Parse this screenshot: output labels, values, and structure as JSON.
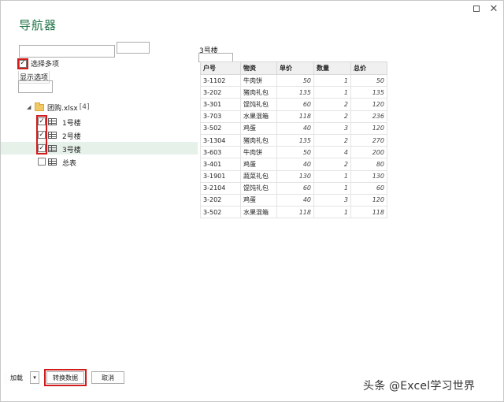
{
  "window": {
    "title": "导航器",
    "maximize_icon": "maximize-icon",
    "close_icon": "close-icon",
    "close_glyph": "☐",
    "x_glyph": "✕"
  },
  "left": {
    "search_value": "",
    "select_multiple_label": "选择多项",
    "select_multiple_checked": true,
    "display_options_label": "显示选项",
    "tree": {
      "root_label": "团购.xlsx",
      "root_count": "[4]",
      "items": [
        {
          "label": "1号楼",
          "checked": true,
          "selected": false
        },
        {
          "label": "2号楼",
          "checked": true,
          "selected": false
        },
        {
          "label": "3号楼",
          "checked": true,
          "selected": true
        },
        {
          "label": "总表",
          "checked": false,
          "selected": false
        }
      ]
    }
  },
  "preview": {
    "title": "3号楼",
    "columns": [
      "户号",
      "物资",
      "单价",
      "数量",
      "总价"
    ],
    "rows": [
      [
        "3-1102",
        "牛肉饼",
        "50",
        "1",
        "50"
      ],
      [
        "3-202",
        "猪肉礼包",
        "135",
        "1",
        "135"
      ],
      [
        "3-301",
        "馄饨礼包",
        "60",
        "2",
        "120"
      ],
      [
        "3-703",
        "水果混箱",
        "118",
        "2",
        "236"
      ],
      [
        "3-502",
        "鸡蛋",
        "40",
        "3",
        "120"
      ],
      [
        "3-1304",
        "猪肉礼包",
        "135",
        "2",
        "270"
      ],
      [
        "3-603",
        "牛肉饼",
        "50",
        "4",
        "200"
      ],
      [
        "3-401",
        "鸡蛋",
        "40",
        "2",
        "80"
      ],
      [
        "3-1901",
        "蔬菜礼包",
        "130",
        "1",
        "130"
      ],
      [
        "3-2104",
        "馄饨礼包",
        "60",
        "1",
        "60"
      ],
      [
        "3-202",
        "鸡蛋",
        "40",
        "3",
        "120"
      ],
      [
        "3-502",
        "水果混箱",
        "118",
        "1",
        "118"
      ]
    ]
  },
  "footer": {
    "load_label": "加载",
    "dropdown_glyph": "▾",
    "transform_label": "转换数据",
    "cancel_label": "取消"
  },
  "watermark": "头条 @Excel学习世界",
  "colors": {
    "title": "#217346",
    "highlight": "#d21c1c",
    "selected_row": "#e6f1ea"
  }
}
